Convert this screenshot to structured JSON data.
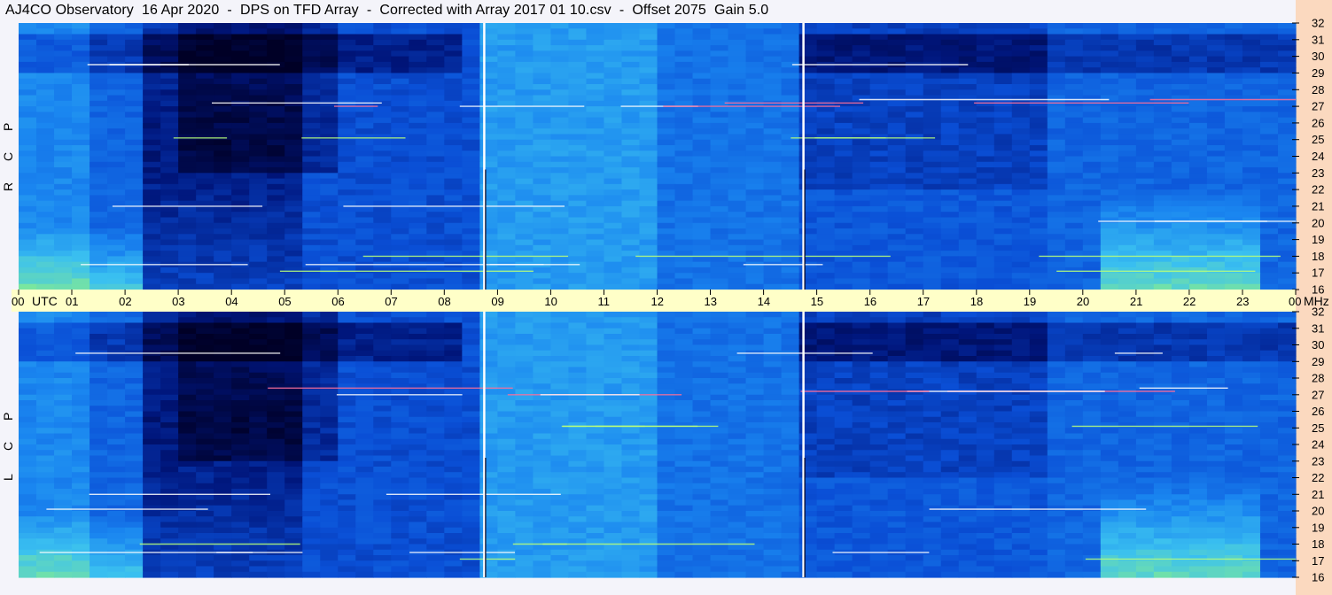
{
  "title": "AJ4CO Observatory  16 Apr 2020  -  DPS on TFD Array  -  Corrected with Array 2017 01 10.csv  -  Offset 2075  Gain 5.0",
  "colors": {
    "background": "#f4f4fa",
    "axis_band": "#ffffc8",
    "right_strip": "#fbd9bf",
    "colormap": [
      "#000026",
      "#00157a",
      "#0a4fd6",
      "#1a86f0",
      "#3ac0f0",
      "#7de89a",
      "#e8f06a",
      "#ff5a8a",
      "#ffffff"
    ]
  },
  "chart_data": [
    {
      "type": "heatmap",
      "name": "R C P",
      "xlabel": "UTC",
      "ylabel": "MHz",
      "xlim": [
        0,
        24
      ],
      "ylim": [
        16,
        32
      ],
      "y_ticks": [
        "32",
        "31",
        "30",
        "29",
        "28",
        "27",
        "26",
        "25",
        "24",
        "23",
        "22",
        "21",
        "20",
        "19",
        "18",
        "17",
        "16"
      ],
      "vertical_markers_utc": [
        8.75,
        14.75
      ]
    },
    {
      "type": "heatmap",
      "name": "L C P",
      "xlabel": "UTC",
      "ylabel": "MHz",
      "xlim": [
        0,
        24
      ],
      "ylim": [
        16,
        32
      ],
      "y_ticks": [
        "32",
        "31",
        "30",
        "29",
        "28",
        "27",
        "26",
        "25",
        "24",
        "23",
        "22",
        "21",
        "20",
        "19",
        "18",
        "17",
        "16"
      ],
      "vertical_markers_utc": [
        8.75,
        14.75
      ]
    }
  ],
  "time_axis": {
    "ticks": [
      "00",
      "01",
      "02",
      "03",
      "04",
      "05",
      "06",
      "07",
      "08",
      "09",
      "10",
      "11",
      "12",
      "13",
      "14",
      "15",
      "16",
      "17",
      "18",
      "19",
      "20",
      "21",
      "22",
      "23",
      "00"
    ],
    "utc_label": "UTC",
    "mhz_label": "MHz"
  },
  "polarization_labels": {
    "top": [
      "R",
      "C",
      "P"
    ],
    "bottom": [
      "L",
      "C",
      "P"
    ]
  }
}
